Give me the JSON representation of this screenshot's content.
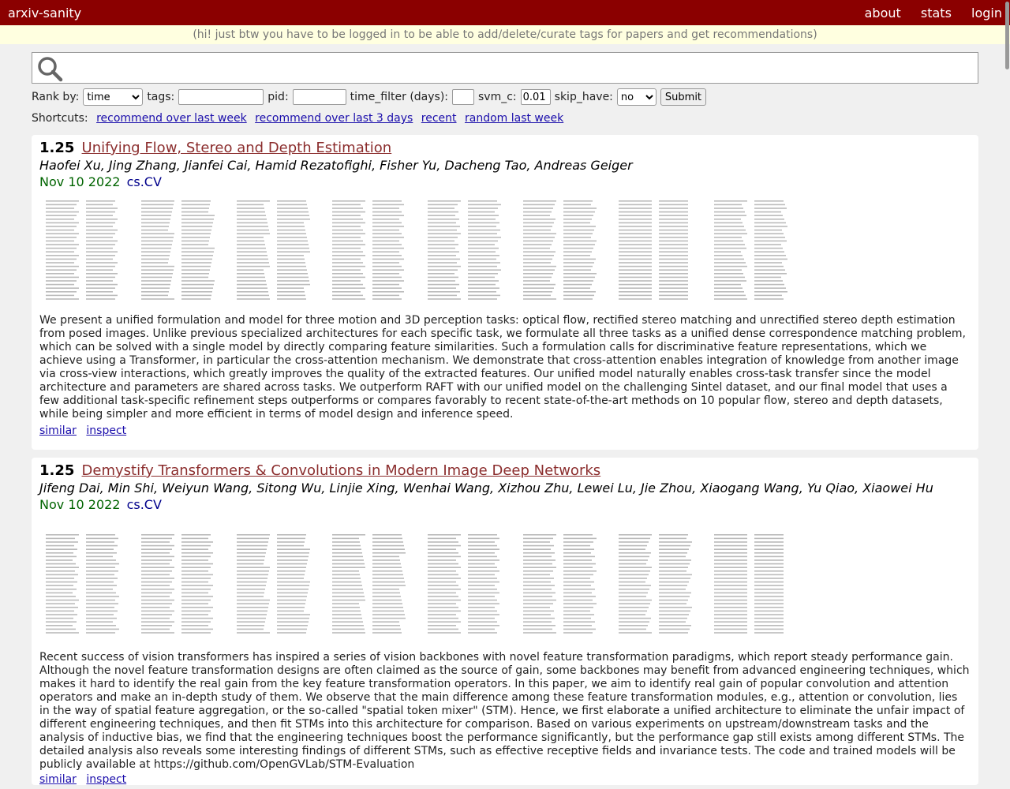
{
  "header": {
    "brand": "arxiv-sanity",
    "nav": [
      "about",
      "stats",
      "login"
    ]
  },
  "banner": "(hi! just btw you have to be logged in to be able to add/delete/curate tags for papers and get recommendations)",
  "search": {
    "value": "",
    "placeholder": ""
  },
  "controls": {
    "rank_label": "Rank by:",
    "rank_value": "time",
    "tags_label": "tags:",
    "tags_value": "",
    "pid_label": "pid:",
    "pid_value": "",
    "time_filter_label": "time_filter (days):",
    "time_filter_value": "",
    "svm_c_label": "svm_c:",
    "svm_c_value": "0.01",
    "skip_have_label": "skip_have:",
    "skip_have_value": "no",
    "submit_label": "Submit"
  },
  "shortcuts": {
    "label": "Shortcuts:",
    "links": [
      "recommend over last week",
      "recommend over last 3 days",
      "recent",
      "random last week"
    ]
  },
  "papers": [
    {
      "rating": "1.25",
      "title": "Unifying Flow, Stereo and Depth Estimation",
      "authors": "Haofei Xu, Jing Zhang, Jianfei Cai, Hamid Rezatofighi, Fisher Yu, Dacheng Tao, Andreas Geiger",
      "date": "Nov 10 2022",
      "category": "cs.CV",
      "abstract": "We present a unified formulation and model for three motion and 3D perception tasks: optical flow, rectified stereo matching and unrectified stereo depth estimation from posed images. Unlike previous specialized architectures for each specific task, we formulate all three tasks as a unified dense correspondence matching problem, which can be solved with a single model by directly comparing feature similarities. Such a formulation calls for discriminative feature representations, which we achieve using a Transformer, in particular the cross-attention mechanism. We demonstrate that cross-attention enables integration of knowledge from another image via cross-view interactions, which greatly improves the quality of the extracted features. Our unified model naturally enables cross-task transfer since the model architecture and parameters are shared across tasks. We outperform RAFT with our unified model on the challenging Sintel dataset, and our final model that uses a few additional task-specific refinement steps outperforms or compares favorably to recent state-of-the-art methods on 10 popular flow, stereo and depth datasets, while being simpler and more efficient in terms of model design and inference speed.",
      "similar_label": "similar",
      "inspect_label": "inspect"
    },
    {
      "rating": "1.25",
      "title": "Demystify Transformers & Convolutions in Modern Image Deep Networks",
      "authors": "Jifeng Dai, Min Shi, Weiyun Wang, Sitong Wu, Linjie Xing, Wenhai Wang, Xizhou Zhu, Lewei Lu, Jie Zhou, Xiaogang Wang, Yu Qiao, Xiaowei Hu",
      "date": "Nov 10 2022",
      "category": "cs.CV",
      "abstract": "Recent success of vision transformers has inspired a series of vision backbones with novel feature transformation paradigms, which report steady performance gain. Although the novel feature transformation designs are often claimed as the source of gain, some backbones may benefit from advanced engineering techniques, which makes it hard to identify the real gain from the key feature transformation operators. In this paper, we aim to identify real gain of popular convolution and attention operators and make an in-depth study of them. We observe that the main difference among these feature transformation modules, e.g., attention or convolution, lies in the way of spatial feature aggregation, or the so-called \"spatial token mixer\" (STM). Hence, we first elaborate a unified architecture to eliminate the unfair impact of different engineering techniques, and then fit STMs into this architecture for comparison. Based on various experiments on upstream/downstream tasks and the analysis of inductive bias, we find that the engineering techniques boost the performance significantly, but the performance gap still exists among different STMs. The detailed analysis also reveals some interesting findings of different STMs, such as effective receptive fields and invariance tests. The code and trained models will be publicly available at https://github.com/OpenGVLab/STM-Evaluation",
      "similar_label": "similar",
      "inspect_label": "inspect"
    }
  ]
}
